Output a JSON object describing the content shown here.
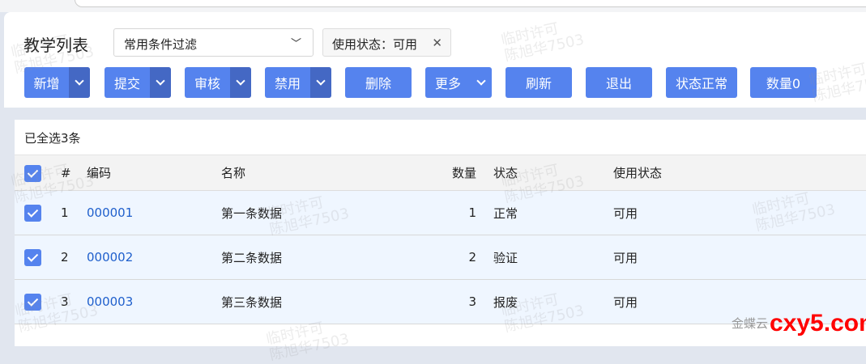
{
  "header": {
    "title": "教学列表",
    "filter_value": "常用条件过滤",
    "tag": "使用状态：可用"
  },
  "toolbar": [
    {
      "label": "新增",
      "dropdown": true
    },
    {
      "label": "提交",
      "dropdown": true
    },
    {
      "label": "审核",
      "dropdown": true
    },
    {
      "label": "禁用",
      "dropdown": true
    },
    {
      "label": "删除"
    },
    {
      "label": "更多",
      "inline_dropdown": true
    },
    {
      "label": "刷新"
    },
    {
      "label": "退出"
    },
    {
      "label": "状态正常"
    },
    {
      "label": "数量0"
    }
  ],
  "table": {
    "selection_info": "已全选3条",
    "columns": [
      "#",
      "编码",
      "名称",
      "数量",
      "状态",
      "使用状态"
    ],
    "rows": [
      {
        "idx": "1",
        "code": "000001",
        "name": "第一条数据",
        "qty": "1",
        "status": "正常",
        "use": "可用",
        "checked": true
      },
      {
        "idx": "2",
        "code": "000002",
        "name": "第二条数据",
        "qty": "2",
        "status": "验证",
        "use": "可用",
        "checked": true
      },
      {
        "idx": "3",
        "code": "000003",
        "name": "第三条数据",
        "qty": "3",
        "status": "报废",
        "use": "可用",
        "checked": true
      }
    ]
  },
  "watermark": "临时许可\n陈旭华7503",
  "footer": {
    "brand": "金蝶云",
    "site": "cxy5.com"
  },
  "colors": {
    "primary": "#5583ee",
    "primary_dark": "#4468c4",
    "link": "#1f5fcc",
    "row_bg": "#eff6ff"
  }
}
